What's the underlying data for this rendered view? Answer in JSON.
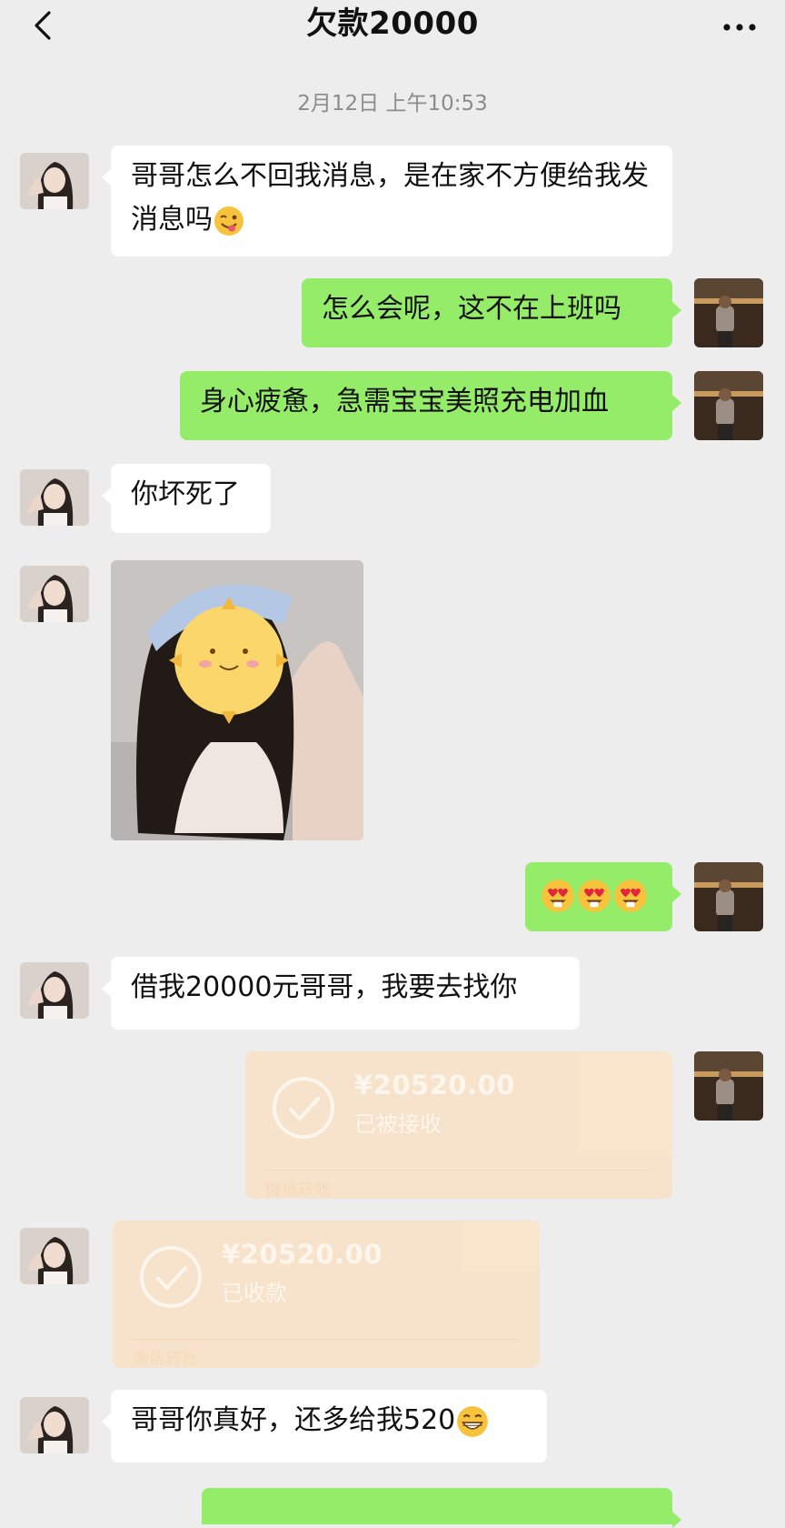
{
  "header": {
    "title": "欠款20000",
    "back_icon": "chevron-left-icon",
    "more_icon": "more-dots-icon"
  },
  "timestamp": "2月12日 上午10:53",
  "messages": [
    {
      "side": "left",
      "type": "text",
      "text": "哥哥怎么不回我消息，是在家不方便给我发消息吗",
      "emoji": "winking-tongue-emoji"
    },
    {
      "side": "right",
      "type": "text",
      "text": "怎么会呢，这不在上班吗"
    },
    {
      "side": "right",
      "type": "text",
      "text": "身心疲惫，急需宝宝美照充电加血"
    },
    {
      "side": "left",
      "type": "text",
      "text": "你坏死了"
    },
    {
      "side": "left",
      "type": "image",
      "description": "photo"
    },
    {
      "side": "right",
      "type": "emoji",
      "emoji": [
        "heart-eyes-emoji",
        "heart-eyes-emoji",
        "heart-eyes-emoji"
      ]
    },
    {
      "side": "left",
      "type": "text",
      "text": "借我20000元哥哥，我要去找你"
    },
    {
      "side": "right",
      "type": "transfer",
      "amount": "¥20520.00",
      "status": "已被接收",
      "footer": "微信转账"
    },
    {
      "side": "left",
      "type": "transfer",
      "amount": "¥20520.00",
      "status": "已收款",
      "footer": "微信转账"
    },
    {
      "side": "left",
      "type": "text",
      "text": "哥哥你真好，还多给我520",
      "emoji": "grinning-emoji"
    }
  ],
  "colors": {
    "background": "#ededed",
    "bubble_self": "#95ec69",
    "bubble_other": "#ffffff",
    "transfer_card": "#f9e3c8"
  }
}
